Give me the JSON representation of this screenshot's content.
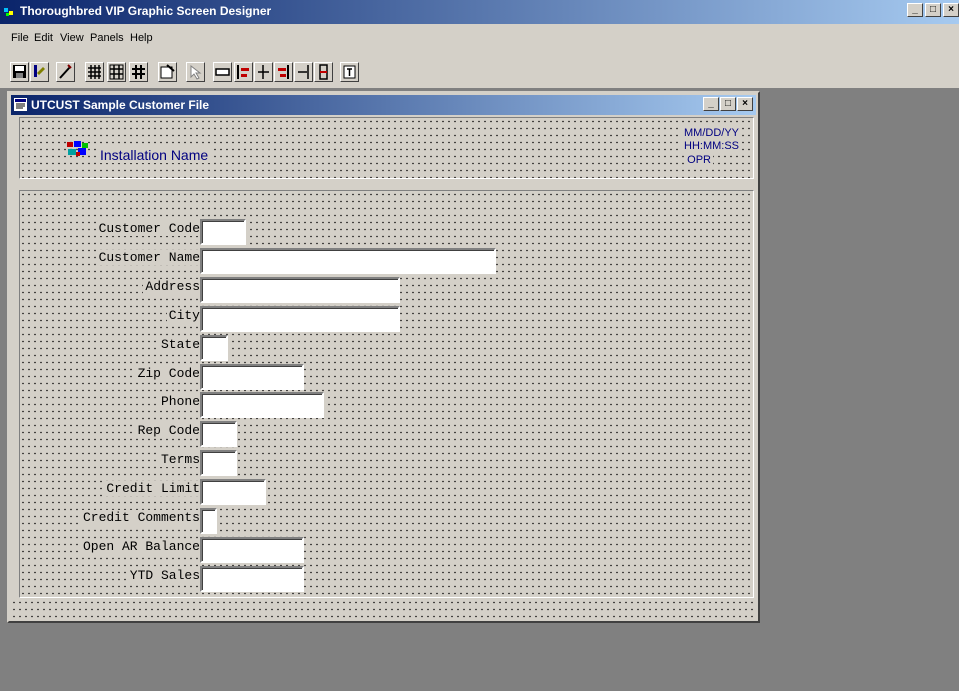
{
  "app": {
    "title": "Thoroughbred VIP Graphic Screen Designer"
  },
  "menu": [
    "File",
    "Edit",
    "View",
    "Panels",
    "Help"
  ],
  "toolbar": {
    "icons": [
      "save-icon",
      "open-icon",
      "wand-icon",
      "grid-dense-icon",
      "grid-icon",
      "grid-bold-icon",
      "properties-icon",
      "pointer-icon",
      "field-icon",
      "align-left-icon",
      "align-center-icon",
      "align-right-icon",
      "align-right-edge-icon",
      "align-vertical-icon",
      "text-icon"
    ]
  },
  "child": {
    "title": "UTCUST  Sample Customer File"
  },
  "header": {
    "installation_name": "Installation Name",
    "date": "MM/DD/YY",
    "time": "HH:MM:SS",
    "operator": "OPR"
  },
  "fields": [
    {
      "label": "Customer Code"
    },
    {
      "label": "Customer Name"
    },
    {
      "label": "Address"
    },
    {
      "label": "City"
    },
    {
      "label": "State"
    },
    {
      "label": "Zip Code"
    },
    {
      "label": "Phone"
    },
    {
      "label": "Rep Code"
    },
    {
      "label": "Terms"
    },
    {
      "label": "Credit Limit"
    },
    {
      "label": "Credit Comments"
    },
    {
      "label": "Open AR Balance"
    },
    {
      "label": "YTD Sales"
    }
  ],
  "colors": {
    "title_gradient_start": "#0a246a",
    "title_gradient_end": "#a6caf0",
    "header_text": "#000080",
    "face": "#d4d0c8",
    "desktop": "#808080"
  }
}
